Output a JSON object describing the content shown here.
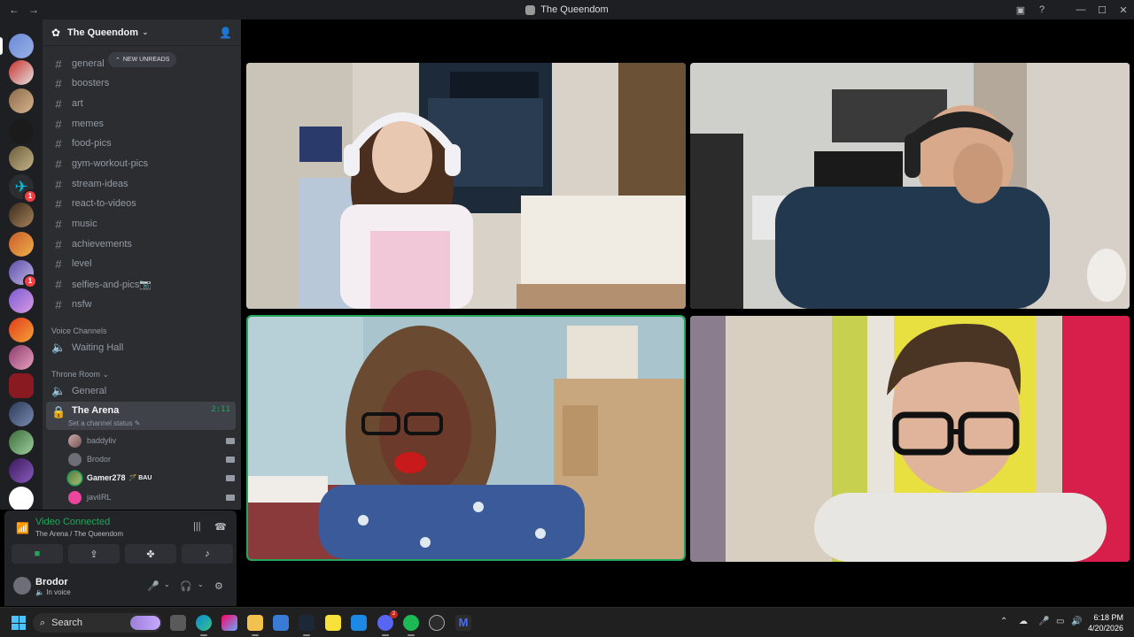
{
  "window": {
    "title": "The Queendom",
    "back": "←",
    "forward": "→"
  },
  "server": {
    "name": "The Queendom",
    "new_unreads": "NEW UNREADS"
  },
  "text_channels": [
    "general",
    "boosters",
    "art",
    "memes",
    "food-pics",
    "gym-workout-pics",
    "stream-ideas",
    "react-to-videos",
    "music",
    "achievements",
    "level",
    "selfies-and-pics📷",
    "nsfw"
  ],
  "categories": {
    "voice": "Voice Channels",
    "throne": "Throne Room"
  },
  "voice_channels": {
    "waiting": "Waiting Hall",
    "general": "General",
    "arena": "The Arena",
    "arena_timer": "2:11",
    "arena_status": "Set a channel status"
  },
  "voice_users": [
    {
      "name": "baddyliv",
      "bold": false,
      "tag": ""
    },
    {
      "name": "Brodor",
      "bold": false,
      "tag": ""
    },
    {
      "name": "Gamer278",
      "bold": true,
      "tag": "BAU"
    },
    {
      "name": "javiIRL",
      "bold": false,
      "tag": ""
    }
  ],
  "connection": {
    "status": "Video Connected",
    "location": "The Arena / The Queendom"
  },
  "user": {
    "name": "Brodor",
    "status": "In voice"
  },
  "taskbar": {
    "search": "Search",
    "time": "6:18 PM",
    "date": "4/20/2026"
  },
  "server_badges": [
    "1",
    "1"
  ],
  "taskbar_badge": "2",
  "colors": {
    "online": "#23a55a",
    "accent": "#5865f2",
    "mention": "#f23f43"
  }
}
